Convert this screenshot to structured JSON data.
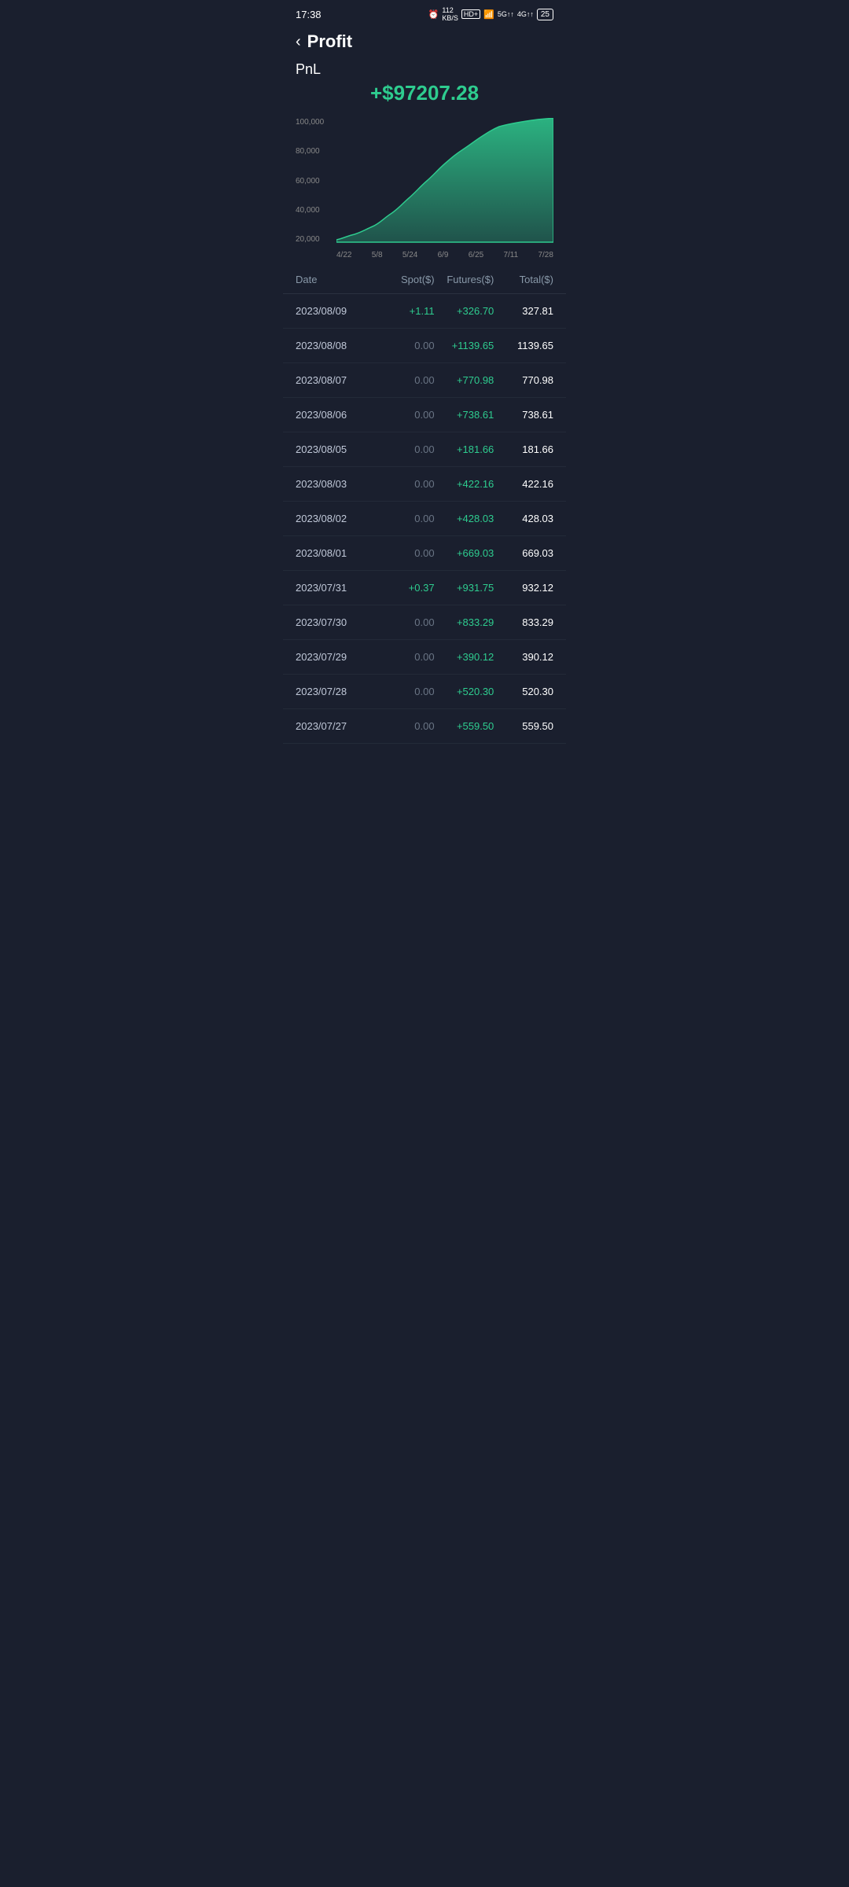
{
  "statusBar": {
    "time": "17:38",
    "icons": "alarm wifi signal battery"
  },
  "header": {
    "backLabel": "‹",
    "title": "Profit"
  },
  "pnl": {
    "label": "PnL",
    "value": "+$97207.28"
  },
  "chart": {
    "yLabels": [
      "100,000",
      "80,000",
      "60,000",
      "40,000",
      "20,000"
    ],
    "xLabels": [
      "4/22",
      "5/8",
      "5/24",
      "6/9",
      "6/25",
      "7/11",
      "7/28"
    ],
    "color": "#2ecc8f"
  },
  "table": {
    "headers": [
      "Date",
      "Spot($)",
      "Futures($)",
      "Total($)"
    ],
    "rows": [
      {
        "date": "2023/08/09",
        "spot": "+1.11",
        "spotNeutral": false,
        "futures": "+326.70",
        "total": "327.81"
      },
      {
        "date": "2023/08/08",
        "spot": "0.00",
        "spotNeutral": true,
        "futures": "+1139.65",
        "total": "1139.65"
      },
      {
        "date": "2023/08/07",
        "spot": "0.00",
        "spotNeutral": true,
        "futures": "+770.98",
        "total": "770.98"
      },
      {
        "date": "2023/08/06",
        "spot": "0.00",
        "spotNeutral": true,
        "futures": "+738.61",
        "total": "738.61"
      },
      {
        "date": "2023/08/05",
        "spot": "0.00",
        "spotNeutral": true,
        "futures": "+181.66",
        "total": "181.66"
      },
      {
        "date": "2023/08/03",
        "spot": "0.00",
        "spotNeutral": true,
        "futures": "+422.16",
        "total": "422.16"
      },
      {
        "date": "2023/08/02",
        "spot": "0.00",
        "spotNeutral": true,
        "futures": "+428.03",
        "total": "428.03"
      },
      {
        "date": "2023/08/01",
        "spot": "0.00",
        "spotNeutral": true,
        "futures": "+669.03",
        "total": "669.03"
      },
      {
        "date": "2023/07/31",
        "spot": "+0.37",
        "spotNeutral": false,
        "futures": "+931.75",
        "total": "932.12"
      },
      {
        "date": "2023/07/30",
        "spot": "0.00",
        "spotNeutral": true,
        "futures": "+833.29",
        "total": "833.29"
      },
      {
        "date": "2023/07/29",
        "spot": "0.00",
        "spotNeutral": true,
        "futures": "+390.12",
        "total": "390.12"
      },
      {
        "date": "2023/07/28",
        "spot": "0.00",
        "spotNeutral": true,
        "futures": "+520.30",
        "total": "520.30"
      },
      {
        "date": "2023/07/27",
        "spot": "0.00",
        "spotNeutral": true,
        "futures": "+559.50",
        "total": "559.50"
      }
    ]
  }
}
